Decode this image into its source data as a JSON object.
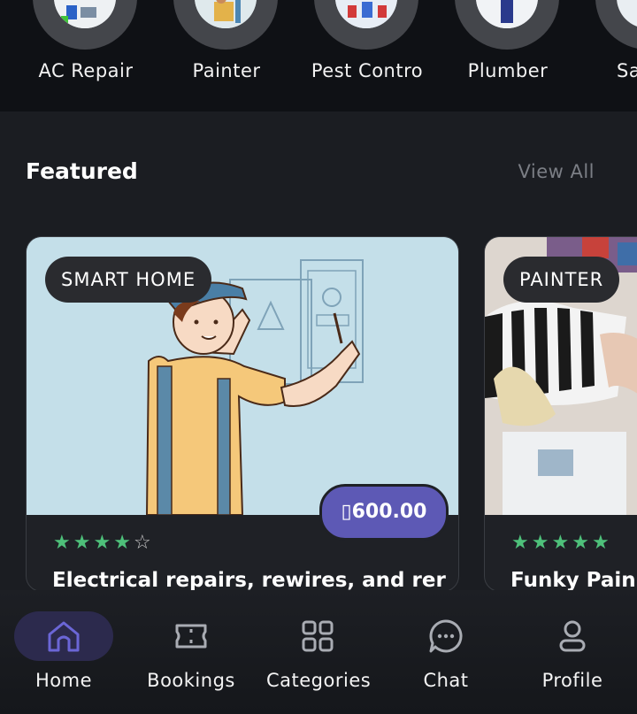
{
  "categories": [
    {
      "label": "AC Repair",
      "icon": "ac-repair-icon"
    },
    {
      "label": "Painter",
      "icon": "painter-icon"
    },
    {
      "label": "Pest Contro",
      "icon": "pest-control-icon"
    },
    {
      "label": "Plumber",
      "icon": "plumber-icon"
    },
    {
      "label": "Sa",
      "icon": "category-icon"
    }
  ],
  "featured": {
    "title": "Featured",
    "view_all": "View All"
  },
  "cards": [
    {
      "badge": "SMART HOME",
      "price": "▯600.00",
      "rating": 4,
      "rating_max": 5,
      "title": "Electrical repairs, rewires, and rer"
    },
    {
      "badge": "PAINTER",
      "rating": 5,
      "rating_max": 5,
      "title": "Funky Pain"
    }
  ],
  "colors": {
    "accent": "#5d59b5",
    "star": "#4ec07a",
    "background": "#1b1d22"
  },
  "nav": [
    {
      "label": "Home",
      "icon": "home-icon",
      "active": true
    },
    {
      "label": "Bookings",
      "icon": "ticket-icon",
      "active": false
    },
    {
      "label": "Categories",
      "icon": "grid-icon",
      "active": false
    },
    {
      "label": "Chat",
      "icon": "chat-icon",
      "active": false
    },
    {
      "label": "Profile",
      "icon": "profile-icon",
      "active": false
    }
  ]
}
